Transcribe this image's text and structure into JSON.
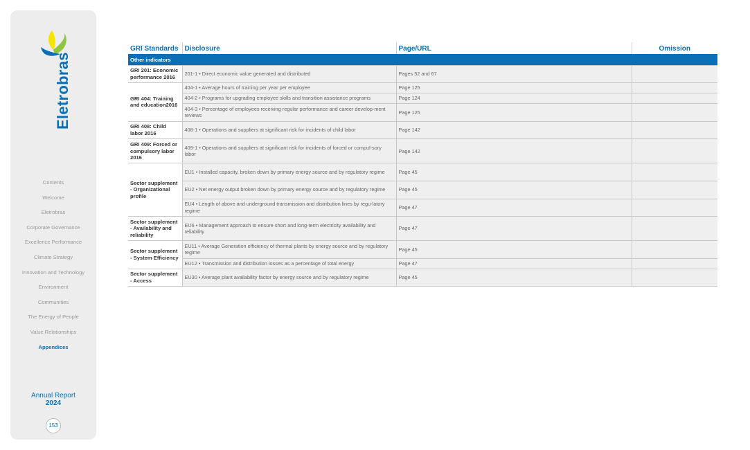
{
  "brand": {
    "name": "Eletrobras",
    "colors": {
      "primary": "#0a6fb4",
      "green": "#8dc63f",
      "yellow": "#f5e500"
    }
  },
  "sidebar": {
    "nav": [
      {
        "label": "Contents",
        "active": false
      },
      {
        "label": "Welcome",
        "active": false
      },
      {
        "label": "Eletrobras",
        "active": false
      },
      {
        "label": "Corporate Governance",
        "active": false
      },
      {
        "label": "Excellence Performance",
        "active": false
      },
      {
        "label": "Climate Strategy",
        "active": false
      },
      {
        "label": "Innovation and Technology",
        "active": false
      },
      {
        "label": "Environment",
        "active": false
      },
      {
        "label": "Communities",
        "active": false
      },
      {
        "label": "The Energy of People",
        "active": false
      },
      {
        "label": "Value Relationships",
        "active": false
      },
      {
        "label": "Appendices",
        "active": true
      }
    ],
    "annual_report_line1": "Annual Report",
    "annual_report_line2": "2024",
    "page_number": "153"
  },
  "table": {
    "headers": {
      "standard": "GRI Standards",
      "disclosure": "Disclosure",
      "page": "Page/URL",
      "omission": "Omission"
    },
    "section": "Other indicators",
    "groups": [
      {
        "standard": "GRI 201: Economic performance 2016",
        "rows": [
          {
            "disclosure": "201-1 • Direct economic value generated and distributed",
            "page": "Pages 52 and 67",
            "omission": "",
            "h": "r2"
          }
        ]
      },
      {
        "standard": "GRI 404: Training and education2016",
        "rows": [
          {
            "disclosure": "404-1 • Average hours of training per year per employee",
            "page": "Page 125",
            "omission": "",
            "h": "r1"
          },
          {
            "disclosure": "404-2 • Programs for upgrading employee skills and transition assistance programs",
            "page": "Page 124",
            "omission": "",
            "h": "r1"
          },
          {
            "disclosure": "404-3 • Percentage of employees receiving regular performance and career develop-ment reviews",
            "page": "Page 125",
            "omission": "",
            "h": "r2"
          }
        ]
      },
      {
        "standard": "GRI 408: Child labor 2016",
        "rows": [
          {
            "disclosure": "408-1 • Operations and suppliers at significant risk for incidents of child labor",
            "page": "Page 142",
            "omission": "",
            "h": "r2"
          }
        ]
      },
      {
        "standard": "GRI 409: Forced or compulsory labor 2016",
        "rows": [
          {
            "disclosure": "409-1 • Operations and suppliers at significant risk for incidents of forced or compul-sory labor",
            "page": "Page 142",
            "omission": "",
            "h": "r3"
          }
        ]
      },
      {
        "standard": "Sector supplement - Organizational profile",
        "rows": [
          {
            "disclosure": "EU1 • Installed capacity, broken down by primary energy source and by regulatory regime",
            "page": "Page 45",
            "omission": "",
            "h": "r2"
          },
          {
            "disclosure": "EU2 • Net energy output broken down by primary energy source and by regulatory regime",
            "page": "Page 45",
            "omission": "",
            "h": "r2"
          },
          {
            "disclosure": "EU4 • Length of above and underground transmission and distribution lines by regu-latory regime",
            "page": "Page 47",
            "omission": "",
            "h": "r2"
          }
        ]
      },
      {
        "standard": "Sector supplement - Availability and reliability",
        "rows": [
          {
            "disclosure": "EU6 • Management approach to ensure short and long-term electricity availability and reliability",
            "page": "Page 47",
            "omission": "",
            "h": "r3"
          }
        ]
      },
      {
        "standard": "Sector supplement - System Efficiency",
        "rows": [
          {
            "disclosure": "EU11 • Average Generation efficiency of thermal plants by energy source and by regulatory regime",
            "page": "Page 45",
            "omission": "",
            "h": "r2"
          },
          {
            "disclosure": "EU12 • Transmission and distribution losses as a percentage of total energy",
            "page": "Page 47",
            "omission": "",
            "h": "r1"
          }
        ]
      },
      {
        "standard": "Sector supplement - Access",
        "rows": [
          {
            "disclosure": "EU30 • Average plant availability factor by energy source and by regulatory regime",
            "page": "Page 45",
            "omission": "",
            "h": "r2"
          }
        ]
      }
    ]
  }
}
